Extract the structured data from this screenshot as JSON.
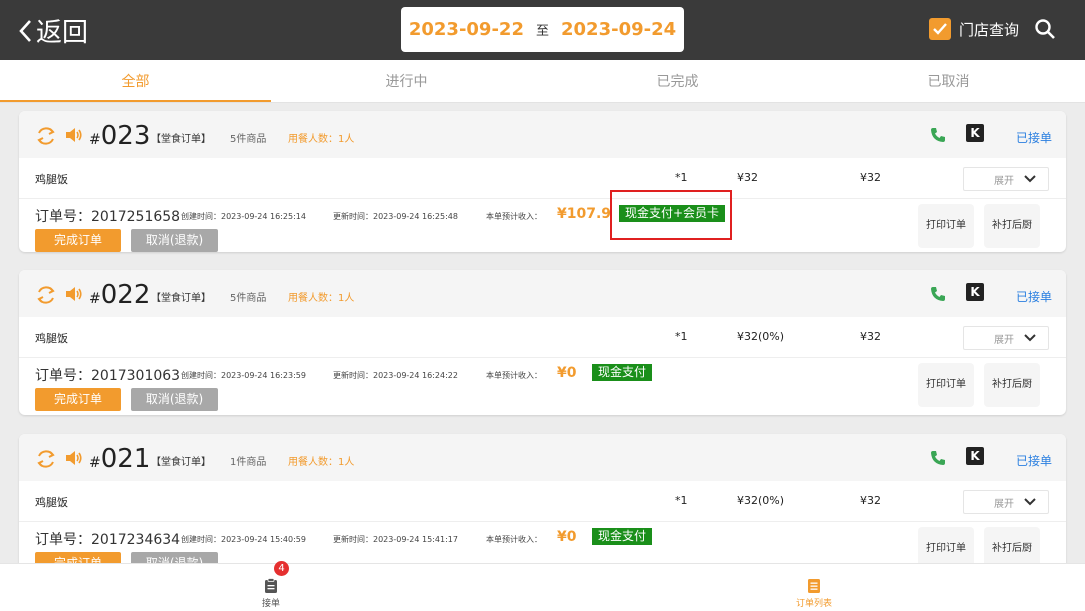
{
  "header": {
    "back_label": "返回",
    "date_from": "2023-09-22",
    "date_sep": "至",
    "date_to": "2023-09-24",
    "store_query_label": "门店查询",
    "store_query_checked": true
  },
  "tabs": [
    {
      "label": "全部",
      "active": true
    },
    {
      "label": "进行中",
      "active": false
    },
    {
      "label": "已完成",
      "active": false
    },
    {
      "label": "已取消",
      "active": false
    }
  ],
  "orders": [
    {
      "hash": "#",
      "number": "023",
      "type": "【堂食订单】",
      "item_count": "5件商品",
      "diners": "用餐人数：1人",
      "status_action": "已接单",
      "k_icon_text": "K",
      "item": {
        "name": "鸡腿饭",
        "qty": "*1",
        "price": "¥32",
        "total": "¥32"
      },
      "expand_label": "展开",
      "order_no": "订单号：2017251658",
      "created": "创建时间：2023-09-24 16:25:14",
      "updated": "更新时间：2023-09-24 16:25:48",
      "income_label": "本单预计收入：",
      "income": "¥107.9",
      "payment": "现金支付+会员卡",
      "complete_label": "完成订单",
      "cancel_label": "取消(退款)",
      "print_label": "打印订单",
      "kitchen_label": "补打后厨"
    },
    {
      "hash": "#",
      "number": "022",
      "type": "【堂食订单】",
      "item_count": "5件商品",
      "diners": "用餐人数：1人",
      "status_action": "已接单",
      "k_icon_text": "K",
      "item": {
        "name": "鸡腿饭",
        "qty": "*1",
        "price": "¥32(0%)",
        "total": "¥32"
      },
      "expand_label": "展开",
      "order_no": "订单号：2017301063",
      "created": "创建时间：2023-09-24 16:23:59",
      "updated": "更新时间：2023-09-24 16:24:22",
      "income_label": "本单预计收入：",
      "income": "¥0",
      "payment": "现金支付",
      "complete_label": "完成订单",
      "cancel_label": "取消(退款)",
      "print_label": "打印订单",
      "kitchen_label": "补打后厨"
    },
    {
      "hash": "#",
      "number": "021",
      "type": "【堂食订单】",
      "item_count": "1件商品",
      "diners": "用餐人数：1人",
      "status_action": "已接单",
      "k_icon_text": "K",
      "item": {
        "name": "鸡腿饭",
        "qty": "*1",
        "price": "¥32(0%)",
        "total": "¥32"
      },
      "expand_label": "展开",
      "order_no": "订单号：2017234634",
      "created": "创建时间：2023-09-24 15:40:59",
      "updated": "更新时间：2023-09-24 15:41:17",
      "income_label": "本单预计收入：",
      "income": "¥0",
      "payment": "现金支付",
      "complete_label": "完成订单",
      "cancel_label": "取消(退款)",
      "print_label": "打印订单",
      "kitchen_label": "补打后厨"
    }
  ],
  "bottom_nav": [
    {
      "label": "接单",
      "badge": "4",
      "active": false
    },
    {
      "label": "订单列表",
      "active": true
    }
  ],
  "colors": {
    "accent": "#f29b2e",
    "link": "#2a7fe0",
    "pay_green": "#1a8f1a",
    "highlight": "#e02020"
  }
}
